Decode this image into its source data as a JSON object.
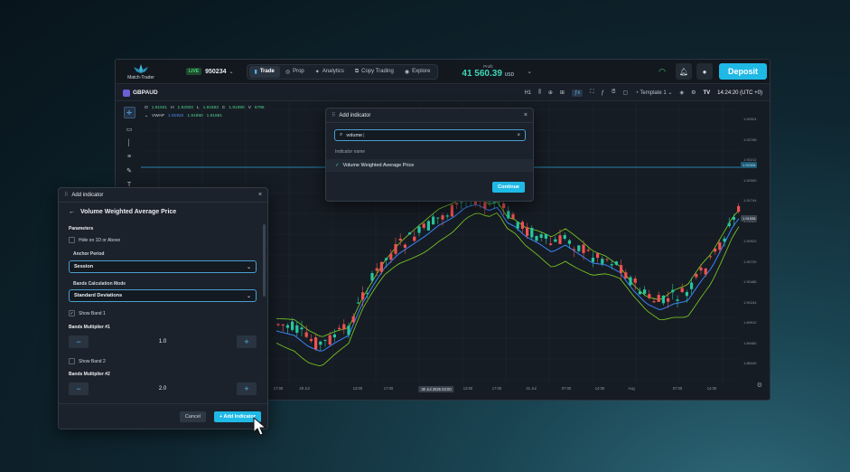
{
  "brand": {
    "name": "Match-Trader"
  },
  "account": {
    "badge": "LIVE",
    "id": "950234"
  },
  "nav": {
    "tabs": [
      {
        "label": "Trade",
        "icon": "chart-bar-icon"
      },
      {
        "label": "Prop",
        "icon": "prop-icon"
      },
      {
        "label": "Analytics",
        "icon": "analytics-icon"
      },
      {
        "label": "Copy Trading",
        "icon": "copy-icon"
      },
      {
        "label": "Explore",
        "icon": "explore-icon"
      }
    ]
  },
  "profit": {
    "label": "Profit",
    "value": "41 560.39",
    "currency": "USD"
  },
  "deposit_label": "Deposit",
  "chart_header": {
    "symbol": "GBPAUD",
    "timeframe": "H1",
    "template": "Template 1",
    "clock": "14:24:20 (UTC +0)"
  },
  "ohlc": {
    "o_lbl": "O",
    "o": "1.91941",
    "h_lbl": "H",
    "h": "1.92000",
    "l_lbl": "L",
    "l": "1.91863",
    "c_lbl": "C",
    "c": "1.91990",
    "v_lbl": "V",
    "v": "6786"
  },
  "vwap": {
    "label": "VWAP",
    "v1": "1.91922",
    "v2": "1.91990",
    "v3": "1.91881"
  },
  "y_axis": {
    "ticks": [
      "1.93324",
      "1.92768",
      "1.92212",
      "1.92000",
      "1.91744",
      "1.91322",
      "1.90922",
      "1.90730",
      "1.90486",
      "1.90244",
      "1.89912",
      "1.89480",
      "1.88440"
    ],
    "current": "1.92326",
    "marker": "1.91538"
  },
  "x_axis": {
    "ticks": [
      "17:00",
      "29 Jul",
      "13:00",
      "17:00",
      "30 Jul 2025 03:00",
      "13:00",
      "17:00",
      "31 Jul",
      "07:00",
      "14:00",
      "Aug",
      "07:00",
      "14:00"
    ]
  },
  "add_indicator_dialog": {
    "title": "Add indicator",
    "search_value": "volume",
    "list_header": "Indicator name",
    "result": "Volume Weighted Average Price",
    "continue_label": "Continue"
  },
  "vwap_dialog": {
    "title": "Add indicator",
    "subtitle": "Volume Weighted Average Price",
    "parameters_label": "Parameters",
    "hide_label": "Hide on 1D or Above",
    "anchor_label": "Anchor Period",
    "anchor_value": "Session",
    "bands_mode_label": "Bands Calculation Mode",
    "bands_mode_value": "Standard Deviations",
    "show_band1": "Show Band 1",
    "mult1_label": "Bands Multiplier #1",
    "mult1_value": "1.0",
    "show_band2": "Show Band 2",
    "mult2_label": "Bands Multiplier #2",
    "mult2_value": "2.0",
    "cancel_label": "Cancel",
    "add_label": "+ Add Indicator"
  },
  "colors": {
    "accent": "#1fb9e6",
    "up": "#26c6a0",
    "down": "#ef5350",
    "vwap": "#3b82f6",
    "band": "#7ed321",
    "hline": "#2aa5d8"
  }
}
